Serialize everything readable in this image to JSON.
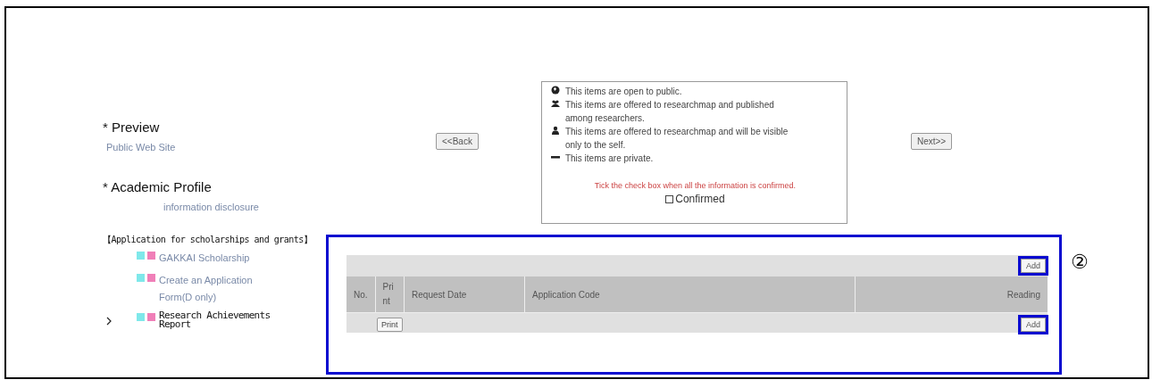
{
  "sidebar": {
    "sections": [
      {
        "heading": "* Preview",
        "links": [
          {
            "label": "Public Web Site",
            "indented": false
          }
        ]
      },
      {
        "heading": "* Academic Profile",
        "links": [
          {
            "label": "information disclosure",
            "indented": true
          }
        ]
      }
    ],
    "group": {
      "title": "【Application for scholarships and grants】",
      "items": [
        {
          "label": "GAKKAI Scholarship",
          "selected": false
        },
        {
          "label": "Create an Application Form(D only)",
          "selected": false
        },
        {
          "label": "Research Achievements Report",
          "selected": true
        }
      ]
    }
  },
  "nav": {
    "back": "<<Back",
    "next": "Next>>"
  },
  "legend": {
    "items": [
      {
        "kind": "public",
        "text": "This items are open to public."
      },
      {
        "kind": "researchers",
        "text": "This items are offered to researchmap and published among researchers."
      },
      {
        "kind": "self",
        "text": "This items are offered to researchmap and will be visible only to the self."
      },
      {
        "kind": "private",
        "text": "This items are private."
      }
    ],
    "notice": "Tick the check box when all the information is confirmed.",
    "confirm": {
      "label": "Confirmed",
      "checked": false
    }
  },
  "panel": {
    "highlighted": true,
    "marker": "②",
    "toolbar": {
      "add": {
        "label": "Add",
        "highlighted": true
      }
    },
    "table": {
      "columns": [
        "No.",
        "Print",
        "Request Date",
        "Application Code",
        "Reading"
      ],
      "row": {
        "print": "Print",
        "add": {
          "label": "Add",
          "highlighted": true
        }
      }
    }
  }
}
